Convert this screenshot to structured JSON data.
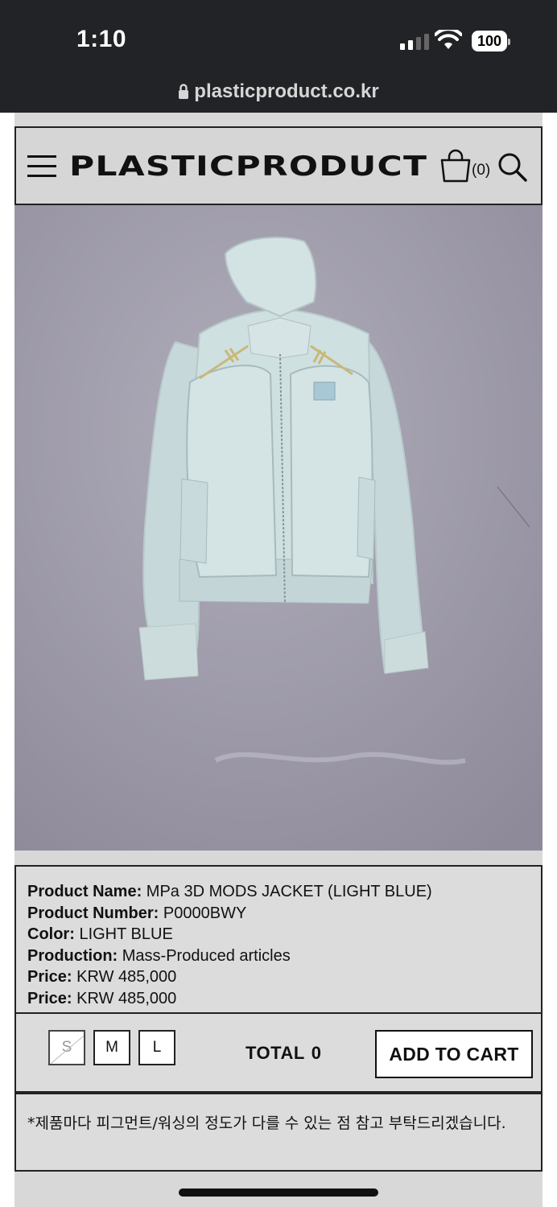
{
  "status_bar": {
    "time": "1:10",
    "battery": "100",
    "url": "plasticproduct.co.kr"
  },
  "header": {
    "logo": "PLASTICPRODUCT",
    "cart_count": "(0)"
  },
  "product": {
    "rows": [
      {
        "label": "Product Name:",
        "value": " MPa 3D MODS JACKET (LIGHT BLUE)"
      },
      {
        "label": "Product Number:",
        "value": " P0000BWY"
      },
      {
        "label": "Color:",
        "value": " LIGHT BLUE"
      },
      {
        "label": "Production:",
        "value": " Mass-Produced articles"
      },
      {
        "label": "Price:",
        "value": " KRW 485,000"
      },
      {
        "label": "Price:",
        "value": " KRW 485,000"
      }
    ]
  },
  "buybar": {
    "sizes": [
      "S",
      "M",
      "L"
    ],
    "total_label": "TOTAL",
    "total_value": "0",
    "add_to_cart": "ADD TO CART"
  },
  "notice": "*제품마다 피그먼트/워싱의 정도가 다를 수 있는 점 참고 부탁드리겠습니다.",
  "colors": {
    "status_bg": "#222326",
    "page_bg": "#d9d9d9",
    "jacket": "#c9dadc",
    "wall": "#9d9aa9"
  }
}
